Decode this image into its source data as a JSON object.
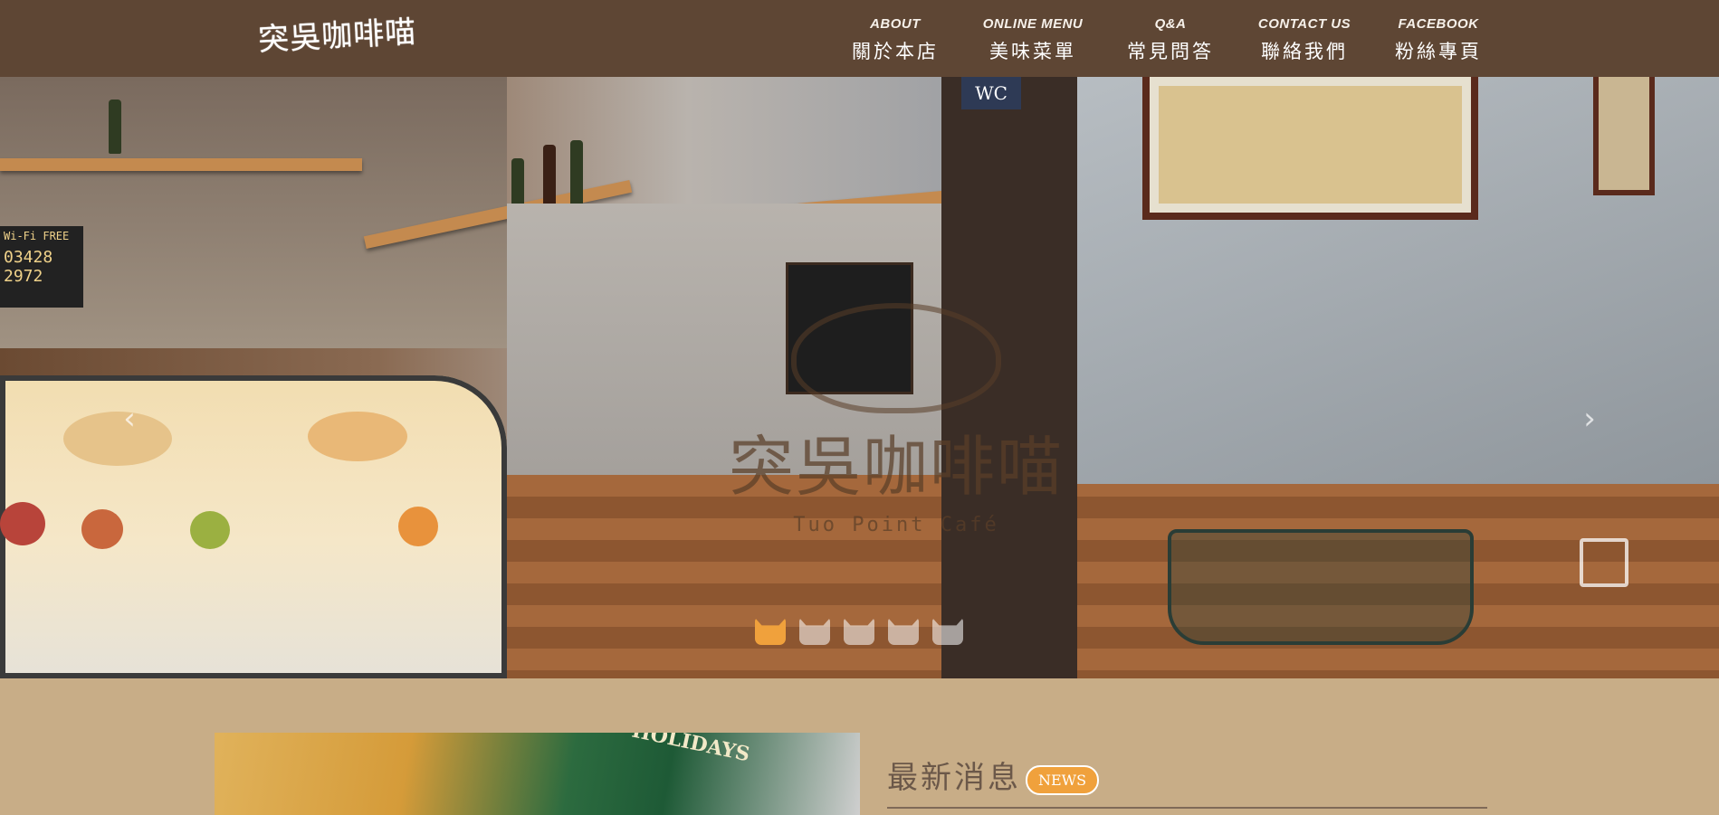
{
  "brand": {
    "logo_text": "突吳咖啡喵"
  },
  "nav": {
    "items": [
      {
        "en": "ABOUT",
        "zh": "關於本店"
      },
      {
        "en": "ONLINE MENU",
        "zh": "美味菜單"
      },
      {
        "en": "Q&A",
        "zh": "常見問答"
      },
      {
        "en": "CONTACT US",
        "zh": "聯絡我們"
      },
      {
        "en": "FACEBOOK",
        "zh": "粉絲專頁"
      }
    ]
  },
  "hero": {
    "watermark_title": "突吳咖啡喵",
    "watermark_sub": "Tuo Point Café",
    "wifi_sign": "Wi-Fi FREE",
    "wifi_code": "03428 2972",
    "wc_sign": "WC",
    "slides_total": 5,
    "active_slide": 1
  },
  "news": {
    "heading": "最新消息",
    "badge": "NEWS",
    "thumb_text": "HOLIDAYS"
  },
  "colors": {
    "header_bg": "#5e4634",
    "page_bg": "#c8ad87",
    "accent": "#f0a13c"
  }
}
